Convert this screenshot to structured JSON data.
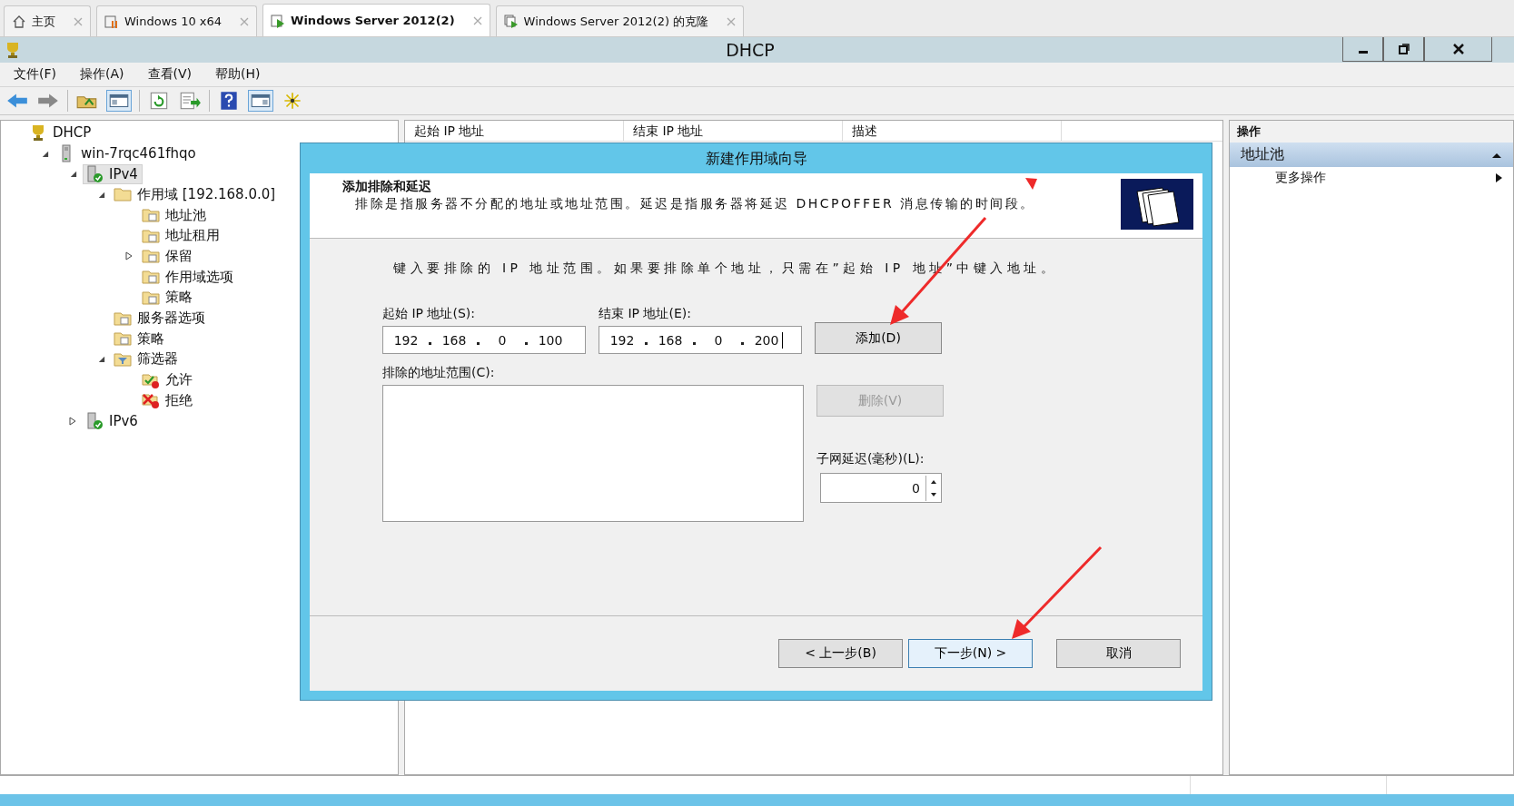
{
  "tabs": [
    {
      "label": "主页",
      "selected": false,
      "kind": "home"
    },
    {
      "label": "Windows 10 x64",
      "selected": false,
      "kind": "vm-paused"
    },
    {
      "label": "Windows Server 2012(2)",
      "selected": true,
      "kind": "vm"
    },
    {
      "label": "Windows Server 2012(2) 的克隆",
      "selected": false,
      "kind": "vm-clone"
    }
  ],
  "window": {
    "title": "DHCP"
  },
  "menu": [
    "文件(F)",
    "操作(A)",
    "查看(V)",
    "帮助(H)"
  ],
  "tree": [
    {
      "label": "DHCP",
      "kind": "root",
      "selected": false,
      "children": [
        {
          "label": "win-7rqc461fhqo",
          "kind": "server",
          "expanded": true,
          "selected": false,
          "children": [
            {
              "label": "IPv4",
              "kind": "protocol",
              "expanded": true,
              "selected": true,
              "children": [
                {
                  "label": "作用域 [192.168.0.0]",
                  "kind": "folder",
                  "expanded": true,
                  "selected": false,
                  "children": [
                    {
                      "label": "地址池",
                      "kind": "folder-doc",
                      "selected": false
                    },
                    {
                      "label": "地址租用",
                      "kind": "folder-doc",
                      "selected": false
                    },
                    {
                      "label": "保留",
                      "kind": "folder-doc",
                      "expanded": false,
                      "selected": false
                    },
                    {
                      "label": "作用域选项",
                      "kind": "folder-doc",
                      "selected": false
                    },
                    {
                      "label": "策略",
                      "kind": "folder-doc",
                      "selected": false
                    }
                  ]
                },
                {
                  "label": "服务器选项",
                  "kind": "folder-doc",
                  "selected": false
                },
                {
                  "label": "策略",
                  "kind": "folder-doc",
                  "selected": false
                },
                {
                  "label": "筛选器",
                  "kind": "filter",
                  "expanded": true,
                  "selected": false,
                  "children": [
                    {
                      "label": "允许",
                      "kind": "allow",
                      "selected": false
                    },
                    {
                      "label": "拒绝",
                      "kind": "deny",
                      "selected": false
                    }
                  ]
                }
              ]
            },
            {
              "label": "IPv6",
              "kind": "protocol",
              "expanded": false,
              "selected": false
            }
          ]
        }
      ]
    }
  ],
  "columns": [
    "起始 IP 地址",
    "结束 IP 地址",
    "描述"
  ],
  "actions": {
    "header": "操作",
    "section": {
      "label": "地址池",
      "expanded": true
    },
    "items": [
      {
        "label": "更多操作"
      }
    ]
  },
  "dialog": {
    "title": "新建作用域向导",
    "heading": "添加排除和延迟",
    "description": "排除是指服务器不分配的地址或地址范围。延迟是指服务器将延迟 DHCPOFFER 消息传输的时间段。",
    "instruction": "键入要排除的 IP 地址范围。如果要排除单个地址，只需在”起始 IP 地址”中键入地址。",
    "start_label": "起始 IP 地址(S):",
    "start_ip": [
      "192",
      "168",
      "0",
      "100"
    ],
    "start_focused": false,
    "end_label": "结束 IP 地址(E):",
    "end_ip": [
      "192",
      "168",
      "0",
      "200"
    ],
    "end_focused": true,
    "add_button": {
      "label": "添加(D)",
      "disabled": false
    },
    "list_label": "排除的地址范围(C):",
    "remove_button": {
      "label": "删除(V)",
      "disabled": true
    },
    "delay_label": "子网延迟(毫秒)(L):",
    "delay_value": "0",
    "buttons": [
      {
        "label": "< 上一步(B)",
        "default": false
      },
      {
        "label": "下一步(N) >",
        "default": true
      },
      {
        "label": "取消",
        "default": false
      }
    ]
  }
}
